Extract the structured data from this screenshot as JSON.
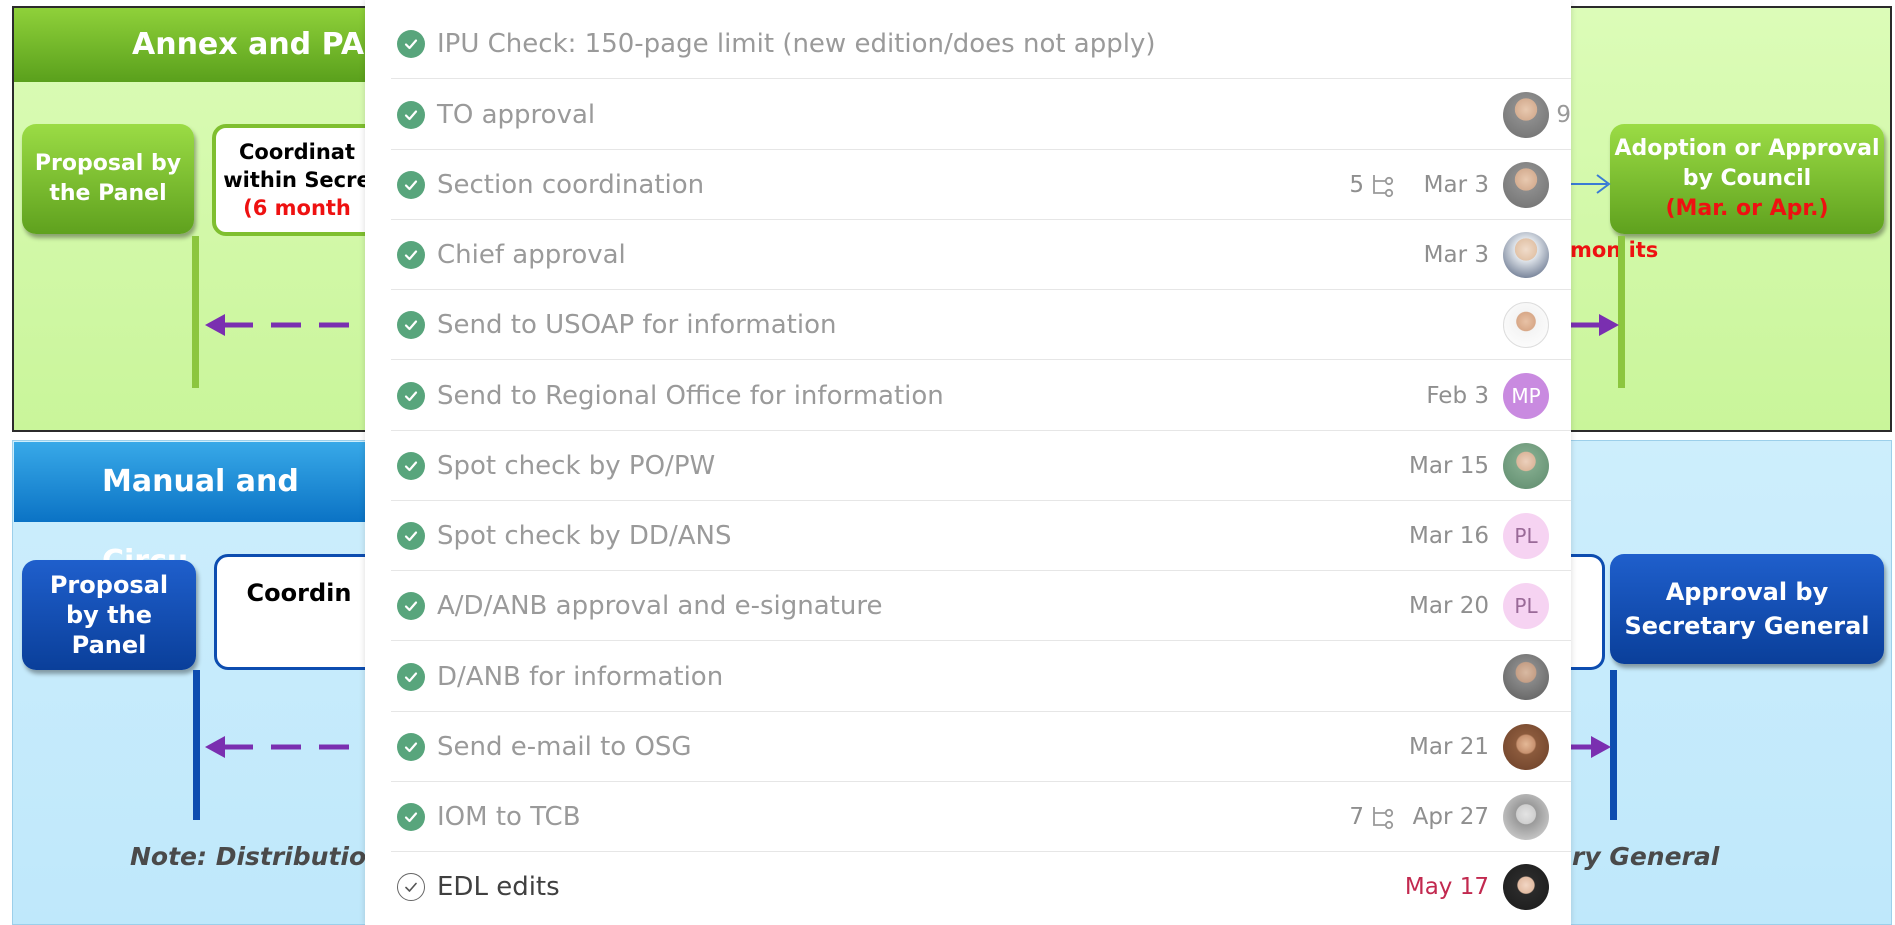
{
  "diagram": {
    "top_banner": "Annex and PAN",
    "bottom_banner": "Manual and Circu",
    "top_left_box": [
      "Proposal by",
      "the Panel"
    ],
    "top_mid_box": [
      "Coordinat",
      "within Secre",
      "(6 month"
    ],
    "top_right_box": [
      "Adoption or Approval",
      "by Council",
      "(Mar. or Apr.)"
    ],
    "top_right_fragment": "mon its",
    "bottom_left_box": [
      "Proposal",
      "by the",
      "Panel"
    ],
    "bottom_mid_box": "Coordin",
    "bottom_right_box": [
      "Approval by",
      "Secretary General"
    ],
    "note_left": "Note: Distribution",
    "note_right": "ry General",
    "colors": {
      "green": "#5fa11e",
      "navy": "#0a3f9a",
      "dash": "#7a2fb0"
    }
  },
  "tasks": [
    {
      "title": "IPU Check: 150-page limit (new edition/does not apply)",
      "done": true,
      "date": "",
      "subtasks": "",
      "avatar": "",
      "avatar_type": "none"
    },
    {
      "title": "TO approval",
      "done": true,
      "date": "",
      "subtasks": "",
      "avatar": "",
      "avatar_type": "photo",
      "trailing": "9"
    },
    {
      "title": "Section coordination",
      "done": true,
      "date": "Mar 3",
      "subtasks": "5",
      "avatar": "",
      "avatar_type": "photo"
    },
    {
      "title": "Chief approval",
      "done": true,
      "date": "Mar 3",
      "subtasks": "",
      "avatar": "",
      "avatar_type": "photo"
    },
    {
      "title": "Send to USOAP for information",
      "done": true,
      "date": "",
      "subtasks": "",
      "avatar": "",
      "avatar_type": "photo"
    },
    {
      "title": "Send to Regional Office for information",
      "done": true,
      "date": "Feb 3",
      "subtasks": "",
      "avatar": "MP",
      "avatar_type": "initials-mp"
    },
    {
      "title": "Spot check by PO/PW",
      "done": true,
      "date": "Mar 15",
      "subtasks": "",
      "avatar": "",
      "avatar_type": "photo"
    },
    {
      "title": "Spot check by DD/ANS",
      "done": true,
      "date": "Mar 16",
      "subtasks": "",
      "avatar": "PL",
      "avatar_type": "initials-pl"
    },
    {
      "title": "A/D/ANB approval and e-signature",
      "done": true,
      "date": "Mar 20",
      "subtasks": "",
      "avatar": "PL",
      "avatar_type": "initials-pl"
    },
    {
      "title": "D/ANB for information",
      "done": true,
      "date": "",
      "subtasks": "",
      "avatar": "",
      "avatar_type": "photo"
    },
    {
      "title": "Send e-mail to OSG",
      "done": true,
      "date": "Mar 21",
      "subtasks": "",
      "avatar": "",
      "avatar_type": "photo"
    },
    {
      "title": "IOM to TCB",
      "done": true,
      "date": "Apr 27",
      "subtasks": "7",
      "avatar": "",
      "avatar_type": "photo"
    },
    {
      "title": "EDL edits",
      "done": false,
      "date": "May 17",
      "subtasks": "",
      "avatar": "",
      "avatar_type": "photo",
      "date_overdue": true
    }
  ],
  "icons": {
    "check": "check-circle-icon",
    "subtask": "subtask-icon",
    "open_check": "empty-check-circle-icon"
  }
}
